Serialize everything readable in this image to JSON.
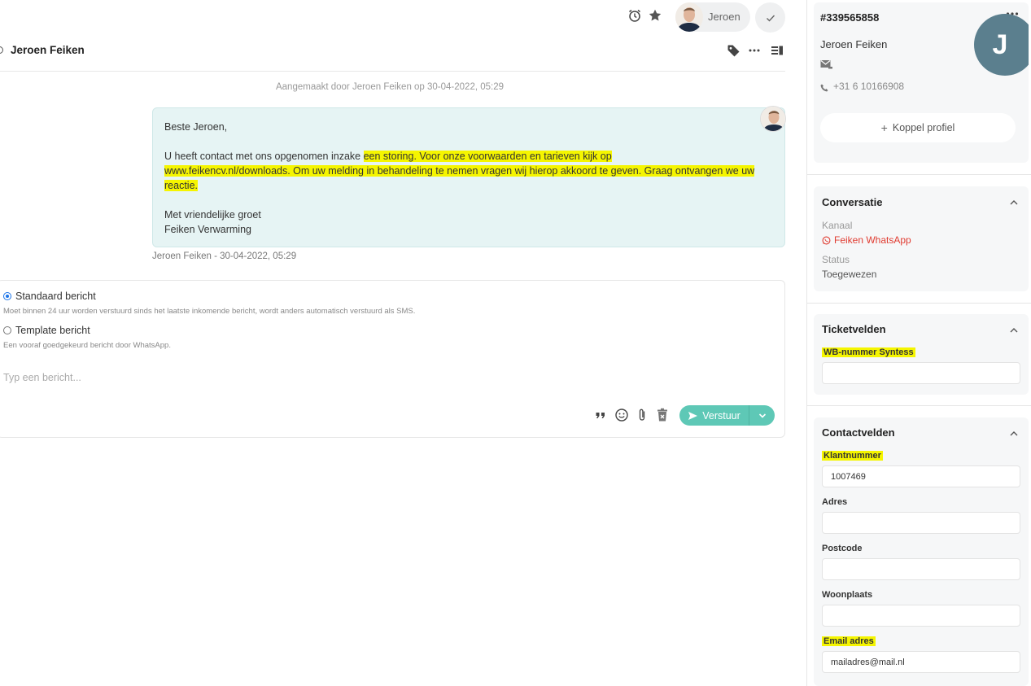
{
  "topbar": {
    "agent_name": "Jeroen"
  },
  "conversation": {
    "title": "Jeroen Feiken",
    "created_line": "Aangemaakt door Jeroen Feiken op 30-04-2022, 05:29",
    "message": {
      "greeting": "Beste Jeroen,",
      "body_plain": "U heeft contact met ons opgenomen inzake ",
      "body_highlight_1": "een storing. Voor onze voorwaarden en tarieven kijk op",
      "body_highlight_2": "www.feikencv.nl/downloads. Om uw melding in behandeling te nemen vragen wij hierop akkoord te geven. Graag ontvangen we uw reactie.",
      "closing": "Met vriendelijke groet",
      "signature": "Feiken Verwarming"
    },
    "message_meta": "Jeroen Feiken  - 30-04-2022, 05:29"
  },
  "composer": {
    "option_standard": "Standaard bericht",
    "option_standard_hint": "Moet binnen 24 uur worden verstuurd sinds het laatste inkomende bericht, wordt anders automatisch verstuurd als SMS.",
    "option_template": "Template bericht",
    "option_template_hint": "Een vooraf goedgekeurd bericht door WhatsApp.",
    "placeholder": "Typ een bericht...",
    "send_label": "Verstuur"
  },
  "contact": {
    "ticket_id": "#339565858",
    "name": "Jeroen Feiken",
    "phone": "+31 6 10166908",
    "avatar_letter": "J",
    "link_profile": "Koppel profiel"
  },
  "conversatie": {
    "title": "Conversatie",
    "channel_label": "Kanaal",
    "channel_value": "Feiken WhatsApp",
    "status_label": "Status",
    "status_value": "Toegewezen"
  },
  "ticketvelden": {
    "title": "Ticketvelden",
    "wb_label": "WB-nummer Syntess",
    "wb_value": ""
  },
  "contactvelden": {
    "title": "Contactvelden",
    "klantnummer_label": "Klantnummer",
    "klantnummer_value": "1007469",
    "adres_label": "Adres",
    "adres_value": "",
    "postcode_label": "Postcode",
    "postcode_value": "",
    "woonplaats_label": "Woonplaats",
    "woonplaats_value": "",
    "email_label": "Email adres",
    "email_value": "mailadres@mail.nl"
  },
  "colors": {
    "accent": "#5ec8b6",
    "bubble_bg": "#e6f4f4",
    "highlight": "#f5f500",
    "channel": "#e03c31",
    "avatar_bg": "#5b7f8e"
  }
}
